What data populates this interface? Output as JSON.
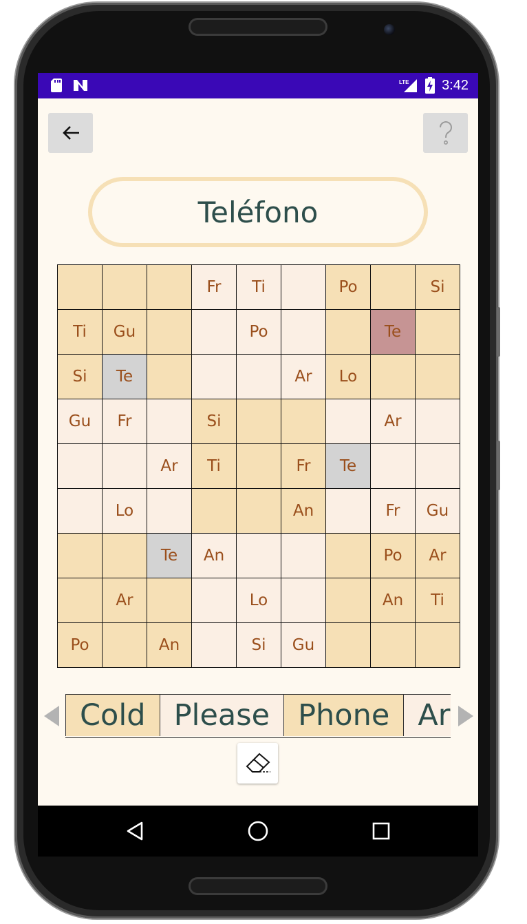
{
  "status_bar": {
    "time": "3:42",
    "network": "LTE",
    "left_icons": [
      "sd-card-icon",
      "notification-n-icon"
    ],
    "right_icons": [
      "signal-icon",
      "battery-charging-icon"
    ],
    "color": "#3a08b6"
  },
  "toolbar": {
    "back_icon": "arrow-left-icon",
    "help_icon": "question-mark-icon"
  },
  "title": "Teléfono",
  "grid": {
    "rows": [
      [
        {
          "t": "",
          "c": "tan"
        },
        {
          "t": "",
          "c": "tan"
        },
        {
          "t": "",
          "c": "tan"
        },
        {
          "t": "Fr",
          "c": "light"
        },
        {
          "t": "Ti",
          "c": "light"
        },
        {
          "t": "",
          "c": "light"
        },
        {
          "t": "Po",
          "c": "tan"
        },
        {
          "t": "",
          "c": "tan"
        },
        {
          "t": "Si",
          "c": "tan"
        }
      ],
      [
        {
          "t": "Ti",
          "c": "tan"
        },
        {
          "t": "Gu",
          "c": "tan"
        },
        {
          "t": "",
          "c": "tan"
        },
        {
          "t": "",
          "c": "light"
        },
        {
          "t": "Po",
          "c": "light"
        },
        {
          "t": "",
          "c": "light"
        },
        {
          "t": "",
          "c": "tan"
        },
        {
          "t": "Te",
          "c": "rose"
        },
        {
          "t": "",
          "c": "tan"
        }
      ],
      [
        {
          "t": "Si",
          "c": "tan"
        },
        {
          "t": "Te",
          "c": "gray"
        },
        {
          "t": "",
          "c": "tan"
        },
        {
          "t": "",
          "c": "light"
        },
        {
          "t": "",
          "c": "light"
        },
        {
          "t": "Ar",
          "c": "light"
        },
        {
          "t": "Lo",
          "c": "tan"
        },
        {
          "t": "",
          "c": "tan"
        },
        {
          "t": "",
          "c": "tan"
        }
      ],
      [
        {
          "t": "Gu",
          "c": "light"
        },
        {
          "t": "Fr",
          "c": "light"
        },
        {
          "t": "",
          "c": "light"
        },
        {
          "t": "Si",
          "c": "tan"
        },
        {
          "t": "",
          "c": "tan"
        },
        {
          "t": "",
          "c": "tan"
        },
        {
          "t": "",
          "c": "light"
        },
        {
          "t": "Ar",
          "c": "light"
        },
        {
          "t": "",
          "c": "light"
        }
      ],
      [
        {
          "t": "",
          "c": "light"
        },
        {
          "t": "",
          "c": "light"
        },
        {
          "t": "Ar",
          "c": "light"
        },
        {
          "t": "Ti",
          "c": "tan"
        },
        {
          "t": "",
          "c": "tan"
        },
        {
          "t": "Fr",
          "c": "tan"
        },
        {
          "t": "Te",
          "c": "gray"
        },
        {
          "t": "",
          "c": "light"
        },
        {
          "t": "",
          "c": "light"
        }
      ],
      [
        {
          "t": "",
          "c": "light"
        },
        {
          "t": "Lo",
          "c": "light"
        },
        {
          "t": "",
          "c": "light"
        },
        {
          "t": "",
          "c": "tan"
        },
        {
          "t": "",
          "c": "tan"
        },
        {
          "t": "An",
          "c": "tan"
        },
        {
          "t": "",
          "c": "light"
        },
        {
          "t": "Fr",
          "c": "light"
        },
        {
          "t": "Gu",
          "c": "light"
        }
      ],
      [
        {
          "t": "",
          "c": "tan"
        },
        {
          "t": "",
          "c": "tan"
        },
        {
          "t": "Te",
          "c": "gray"
        },
        {
          "t": "An",
          "c": "light"
        },
        {
          "t": "",
          "c": "light"
        },
        {
          "t": "",
          "c": "light"
        },
        {
          "t": "",
          "c": "tan"
        },
        {
          "t": "Po",
          "c": "tan"
        },
        {
          "t": "Ar",
          "c": "tan"
        }
      ],
      [
        {
          "t": "",
          "c": "tan"
        },
        {
          "t": "Ar",
          "c": "tan"
        },
        {
          "t": "",
          "c": "tan"
        },
        {
          "t": "",
          "c": "light"
        },
        {
          "t": "Lo",
          "c": "light"
        },
        {
          "t": "",
          "c": "light"
        },
        {
          "t": "",
          "c": "tan"
        },
        {
          "t": "An",
          "c": "tan"
        },
        {
          "t": "Ti",
          "c": "tan"
        }
      ],
      [
        {
          "t": "Po",
          "c": "tan"
        },
        {
          "t": "",
          "c": "tan"
        },
        {
          "t": "An",
          "c": "tan"
        },
        {
          "t": "",
          "c": "light"
        },
        {
          "t": "Si",
          "c": "light"
        },
        {
          "t": "Gu",
          "c": "light"
        },
        {
          "t": "",
          "c": "tan"
        },
        {
          "t": "",
          "c": "tan"
        },
        {
          "t": "",
          "c": "tan"
        }
      ]
    ]
  },
  "words": [
    {
      "label": "Cold",
      "c": "tan"
    },
    {
      "label": "Please",
      "c": "light"
    },
    {
      "label": "Phone",
      "c": "tan"
    },
    {
      "label": "Ar",
      "c": "light"
    }
  ],
  "eraser_icon": "eraser-icon",
  "nav": {
    "back_icon": "nav-back-icon",
    "home_icon": "nav-home-icon",
    "recents_icon": "nav-recents-icon"
  },
  "colors": {
    "tan": "#f6e0b6",
    "light": "#fbefe4",
    "highlight_gray": "#d3d3d3",
    "highlight_rose": "#c69494",
    "cell_text": "#9a4f1c",
    "title_text": "#2d4e4b"
  }
}
